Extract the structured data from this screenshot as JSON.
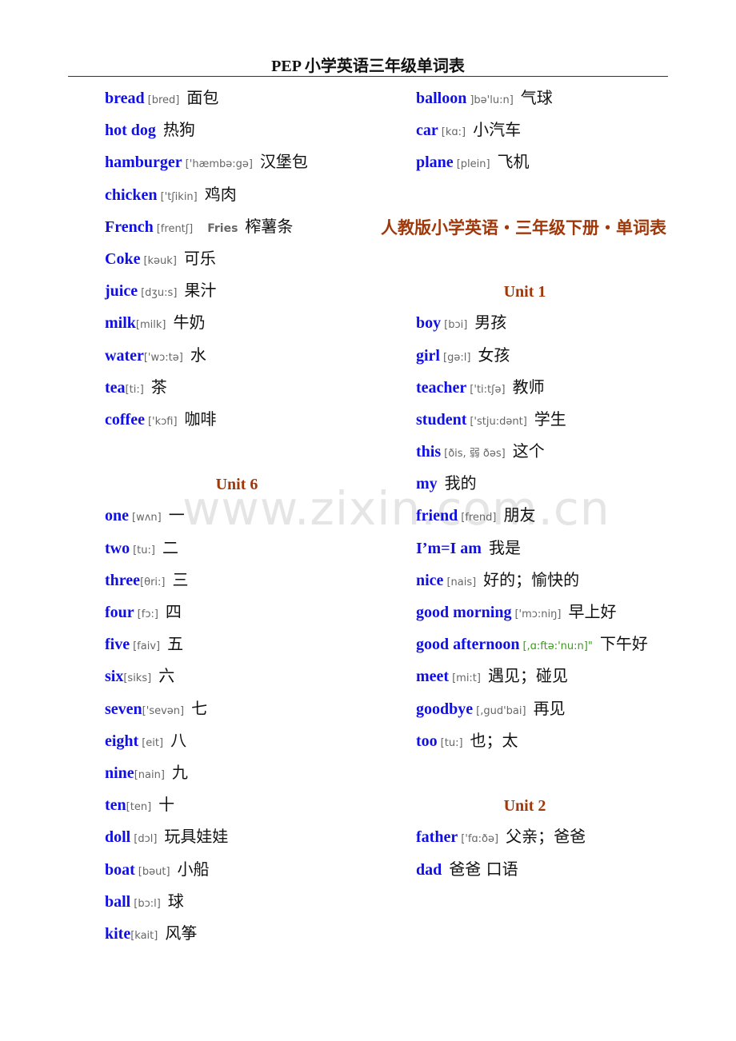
{
  "header": {
    "title": "PEP 小学英语三年级单词表"
  },
  "watermark": "www.zixin.com.cn",
  "left_column": {
    "words_top": [
      {
        "en": "bread",
        "ph": "[bred]",
        "zh": "面包"
      },
      {
        "en": "hot  dog",
        "ph": "",
        "zh": "热狗"
      },
      {
        "en": "hamburger",
        "ph": "['hæmbə:gə]",
        "zh": "汉堡包"
      },
      {
        "en": "chicken",
        "ph": "['tʃikin]",
        "zh": "鸡肉"
      },
      {
        "en": "French",
        "ph": "[frentʃ]",
        "extra": "Fries",
        "zh": "榨薯条"
      },
      {
        "en": "Coke",
        "ph": "[kəuk]",
        "zh": "可乐"
      },
      {
        "en": "juice",
        "ph": "[dʒu:s]",
        "zh": "果汁"
      },
      {
        "en": "milk",
        "ph": "[milk]",
        "zh": "牛奶"
      },
      {
        "en": "water",
        "ph": "['wɔ:tə]",
        "zh": "水"
      },
      {
        "en": "tea",
        "ph": "[ti:]",
        "zh": "茶"
      },
      {
        "en": "coffee",
        "ph": "['kɔfi]",
        "zh": "咖啡"
      }
    ],
    "unit6_title": "Unit  6",
    "unit6_words": [
      {
        "en": "one",
        "ph": "[wʌn]",
        "zh": "一"
      },
      {
        "en": "two",
        "ph": "[tu:]",
        "zh": "二"
      },
      {
        "en": "three",
        "ph": "[θri:]",
        "zh": "三"
      },
      {
        "en": "four",
        "ph": "[fɔ:]",
        "zh": "四"
      },
      {
        "en": "five",
        "ph": "[faiv]",
        "zh": "五"
      },
      {
        "en": "six",
        "ph": "[siks]",
        "zh": "六"
      },
      {
        "en": "seven",
        "ph": "['sevən]",
        "zh": "七"
      },
      {
        "en": "eight",
        "ph": "[eit]",
        "zh": "八"
      },
      {
        "en": "nine",
        "ph": "[nain]",
        "zh": "九"
      },
      {
        "en": "ten",
        "ph": "[ten]",
        "zh": "十"
      },
      {
        "en": "doll",
        "ph": "[dɔl]",
        "zh": "玩具娃娃"
      },
      {
        "en": "boat",
        "ph": "[bəut]",
        "zh": "小船"
      },
      {
        "en": "ball",
        "ph": "[bɔ:l]",
        "zh": "球"
      },
      {
        "en": "kite",
        "ph": "[kait]",
        "zh": "风筝"
      }
    ]
  },
  "right_column": {
    "words_top": [
      {
        "en": "balloon",
        "ph": "]bə'lu:n]",
        "zh": "气球"
      },
      {
        "en": "car",
        "ph": "[kɑ:]",
        "zh": "小汽车"
      },
      {
        "en": "plane",
        "ph": "[plein]",
        "zh": "飞机"
      }
    ],
    "section_title": "人教版小学英语・三年级下册・单词表",
    "unit1_title": "Unit  1",
    "unit1_words": [
      {
        "en": "boy",
        "ph": "[bɔi]",
        "zh": "男孩"
      },
      {
        "en": "girl",
        "ph": "[gə:l]",
        "zh": "女孩"
      },
      {
        "en": "teacher",
        "ph": "['ti:tʃə]",
        "zh": "教师"
      },
      {
        "en": "student",
        "ph": "['stju:dənt]",
        "zh": "学生"
      },
      {
        "en": "this",
        "ph": "[ðis, 弱 ðəs]",
        "zh": "这个"
      },
      {
        "en": "my",
        "ph": "",
        "zh": "我的"
      },
      {
        "en": "friend",
        "ph": "[frend]",
        "zh": "朋友"
      },
      {
        "en": "I’m=I  am",
        "ph": "",
        "zh": "我是"
      },
      {
        "en": "nice",
        "ph": "[nais]",
        "zh": "好的；愉快的"
      },
      {
        "en": "good  morning",
        "ph": "['mɔ:niŋ]",
        "zh": "早上好"
      },
      {
        "en": "good  afternoon",
        "ph": "[,ɑ:ftə:'nu:n]\"",
        "zh": "下午好"
      },
      {
        "en": "meet",
        "ph": "[mi:t]",
        "zh": "遇见；碰见"
      },
      {
        "en": "goodbye",
        "ph": "[,gud'bai]",
        "zh": "再见"
      },
      {
        "en": "too",
        "ph": "[tu:]",
        "zh": "也；太"
      }
    ],
    "unit2_title": "Unit  2",
    "unit2_words": [
      {
        "en": "father",
        "ph": "['fɑ:ðə]",
        "zh": "父亲；爸爸"
      },
      {
        "en": "dad",
        "ph": "",
        "zh": "爸爸  口语"
      }
    ]
  }
}
